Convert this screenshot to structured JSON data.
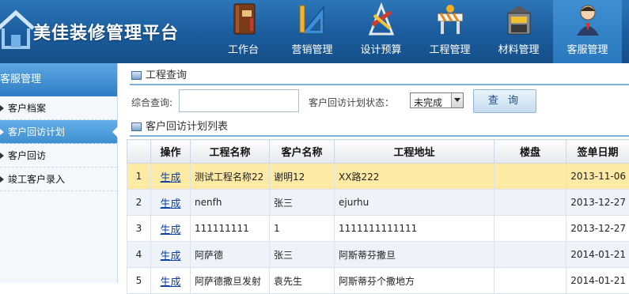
{
  "app": {
    "title": "美佳装修管理平台"
  },
  "nav": {
    "items": [
      {
        "label": "工作台",
        "icon": "book-icon"
      },
      {
        "label": "营销管理",
        "icon": "ruler-triangle-icon"
      },
      {
        "label": "设计预算",
        "icon": "design-tools-icon"
      },
      {
        "label": "工程管理",
        "icon": "construction-barrier-icon"
      },
      {
        "label": "材料管理",
        "icon": "material-store-icon"
      },
      {
        "label": "客服管理",
        "icon": "customer-service-icon"
      }
    ],
    "active_index": 5
  },
  "sidebar": {
    "title": "客服管理",
    "items": [
      {
        "label": "客户档案"
      },
      {
        "label": "客户回访计划"
      },
      {
        "label": "客户回访"
      },
      {
        "label": "竣工客户录入"
      }
    ],
    "active_index": 1
  },
  "query": {
    "section_title": "工程查询",
    "search_label": "综合查询:",
    "search_value": "",
    "status_label": "客户回访计划状态：",
    "status_value": "未完成",
    "button_label": "查 询"
  },
  "list": {
    "section_title": "客户回访计划列表",
    "columns": [
      "",
      "操作",
      "工程名称",
      "客户名称",
      "工程地址",
      "楼盘",
      "签单日期"
    ],
    "rows": [
      {
        "idx": "1",
        "action": "生成",
        "project": "测试工程名称22",
        "customer": "谢明12",
        "address": "XX路222",
        "estate": "",
        "date": "2013-11-06"
      },
      {
        "idx": "2",
        "action": "生成",
        "project": "nenfh",
        "customer": "张三",
        "address": "ejurhu",
        "estate": "",
        "date": "2013-12-27"
      },
      {
        "idx": "3",
        "action": "生成",
        "project": "111111111",
        "customer": "1",
        "address": "1111111111111",
        "estate": "",
        "date": "2013-12-27"
      },
      {
        "idx": "4",
        "action": "生成",
        "project": "阿萨德",
        "customer": "张三",
        "address": "阿斯蒂芬撒旦",
        "estate": "",
        "date": "2014-01-21"
      },
      {
        "idx": "5",
        "action": "生成",
        "project": "阿萨德撒旦发射",
        "customer": "袁先生",
        "address": "阿斯蒂芬个撒地方",
        "estate": "",
        "date": "2014-01-21"
      }
    ]
  },
  "colors": {
    "header_blue": "#1a5c9c",
    "active_nav": "#2a78bd",
    "highlight_row": "#fdeaa4",
    "link": "#0b3fa6"
  }
}
